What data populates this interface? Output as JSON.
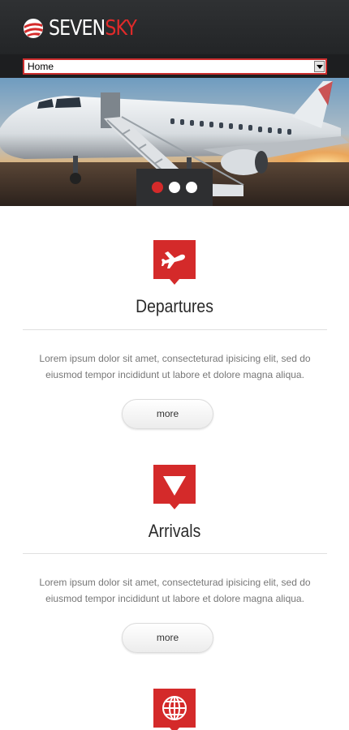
{
  "header": {
    "logo_part1": "SEVEN",
    "logo_part2": "SKY"
  },
  "nav": {
    "selected": "Home"
  },
  "slider": {
    "slides": 3,
    "active": 1
  },
  "sections": [
    {
      "title": "Departures",
      "icon": "plane-icon",
      "text": "Lorem ipsum dolor sit amet, consecteturad ipisicing elit, sed do eiusmod tempor incididunt ut labore et dolore magna aliqua.",
      "button": "more"
    },
    {
      "title": "Arrivals",
      "icon": "arrow-down-icon",
      "text": "Lorem ipsum dolor sit amet, consecteturad ipisicing elit, sed do eiusmod tempor incididunt ut labore et dolore magna aliqua.",
      "button": "more"
    },
    {
      "title": "",
      "icon": "globe-icon"
    }
  ],
  "colors": {
    "accent": "#d42a2a",
    "header_bg": "#2a2c2e",
    "nav_bg": "#1d1e20"
  }
}
